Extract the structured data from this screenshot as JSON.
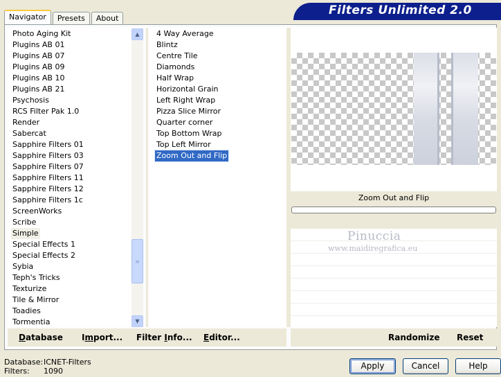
{
  "title": "Filters Unlimited 2.0",
  "tabs": [
    {
      "label": "Navigator",
      "active": true
    },
    {
      "label": "Presets",
      "active": false
    },
    {
      "label": "About",
      "active": false
    }
  ],
  "categories": [
    "Photo Aging Kit",
    "Plugins AB 01",
    "Plugins AB 07",
    "Plugins AB 09",
    "Plugins AB 10",
    "Plugins AB 21",
    "Psychosis",
    "RCS Filter Pak 1.0",
    "Render",
    "Sabercat",
    "Sapphire Filters 01",
    "Sapphire Filters 03",
    "Sapphire Filters 07",
    "Sapphire Filters 11",
    "Sapphire Filters 12",
    "Sapphire Filters 1c",
    "ScreenWorks",
    "Scribe",
    "Simple",
    "Special Effects 1",
    "Special Effects 2",
    "Sybia",
    "Teph's Tricks",
    "Texturize",
    "Tile & Mirror",
    "Toadies",
    "Tormentia"
  ],
  "selected_category": "Simple",
  "filters": [
    "4 Way Average",
    "Blintz",
    "Centre Tile",
    "Diamonds",
    "Half Wrap",
    "Horizontal Grain",
    "Left Right Wrap",
    "Pizza Slice Mirror",
    "Quarter corner",
    "Top Bottom Wrap",
    "Top Left Mirror",
    "Zoom Out and Flip"
  ],
  "selected_filter": "Zoom Out and Flip",
  "preview": {
    "filter_name": "Zoom Out and Flip",
    "progress": 0,
    "watermark_title": "Pinuccia",
    "watermark_url": "www.maidiregrafica.eu"
  },
  "left_buttons": {
    "database": {
      "underline": "D",
      "rest": "atabase"
    },
    "import": {
      "pre": "I",
      "underline": "m",
      "rest": "port..."
    },
    "filter_info": {
      "pre": "Filter ",
      "underline": "I",
      "rest": "nfo..."
    },
    "editor": {
      "underline": "E",
      "rest": "ditor..."
    }
  },
  "right_buttons": {
    "randomize": "Randomize",
    "reset": "Reset"
  },
  "info": {
    "database_label": "Database:",
    "database_value": "ICNET-Filters",
    "filters_label": "Filters:",
    "filters_value": "1090"
  },
  "dialog_buttons": {
    "apply": "Apply",
    "cancel": "Cancel",
    "help": "Help"
  },
  "colors": {
    "title_band": "#0c1f8c",
    "selection": "#316ac5",
    "panel": "#ece9d8"
  }
}
